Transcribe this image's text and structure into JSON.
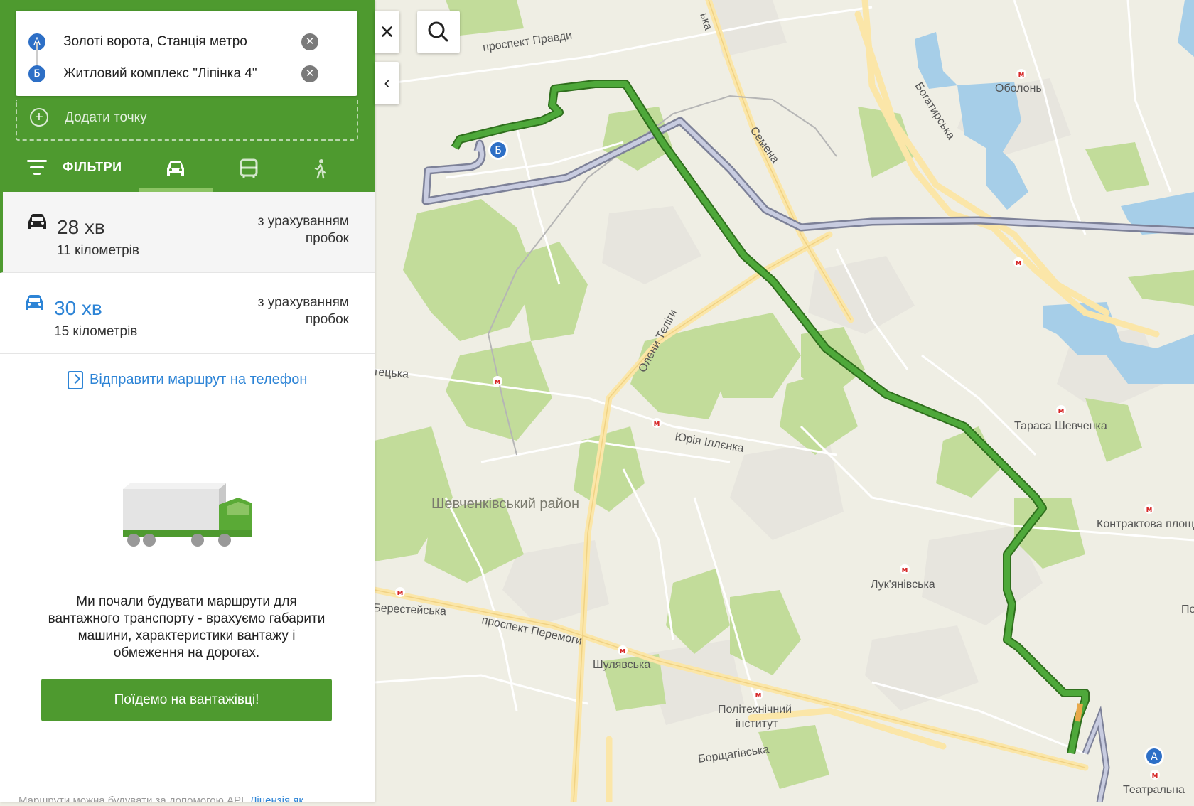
{
  "route": {
    "from_badge": "А",
    "from": "Золоті ворота, Станція метро",
    "to_badge": "Б",
    "to": "Житловий комплекс \"Ліпінка 4\"",
    "add_point": "Додати точку",
    "swap_icon": "swap-arrows-icon",
    "clear_icon": "clear-icon"
  },
  "modes": {
    "filters_label": "ФІЛЬТРИ",
    "active": "car",
    "items": [
      "car",
      "bus",
      "walk"
    ]
  },
  "options": [
    {
      "time": "28 хв",
      "distance": "11 кілометрів",
      "traffic": "з урахуванням пробок",
      "selected": true
    },
    {
      "time": "30 хв",
      "distance": "15 кілометрів",
      "traffic": "з урахуванням пробок",
      "selected": false
    }
  ],
  "send_route": "Відправити маршрут на телефон",
  "truck": {
    "text": "Ми почали будувати маршрути для вантажного транспорту - врахуємо габарити машини, характеристики вантажу і обмеження на дорогах.",
    "button": "Поїдемо на вантажівці!"
  },
  "footer": {
    "text": "Маршрути можна будувати за допомогою API.",
    "link": "Ліцензія як"
  },
  "controls": {
    "close": "✕",
    "collapse": "‹"
  },
  "map": {
    "labels": {
      "pravdy": "проспект Правди",
      "kurenivska": "ька",
      "semena": "Семена",
      "bohatyrska": "Богатирська",
      "obolon": "Оболонь",
      "oleny_telihy": "Олени Теліги",
      "tetsenka": "тецька",
      "yuriya_illenka": "Юрія Іллєнка",
      "taras": "Тараса Шевченка",
      "shevchenkivskyi": "Шевченківський район",
      "kontraktova": "Контрактова площа",
      "lukianivska": "Лук'янівська",
      "beresteiska": "Берестейська",
      "peremohy": "проспект Перемоги",
      "shuliavska": "Шулявська",
      "politech_1": "Політехнічний",
      "politech_2": "інститут",
      "borshchahivska": "Борщагівська",
      "teatralna": "Театральна",
      "po": "По"
    },
    "marker_a": "А",
    "marker_b": "Б",
    "metro_letter": "м",
    "colors": {
      "route_main": "#4ea83a",
      "route_alt": "#a9b0c8",
      "water": "#a6cee8",
      "park": "#c2dc9a",
      "road": "#fbe6a8"
    }
  }
}
